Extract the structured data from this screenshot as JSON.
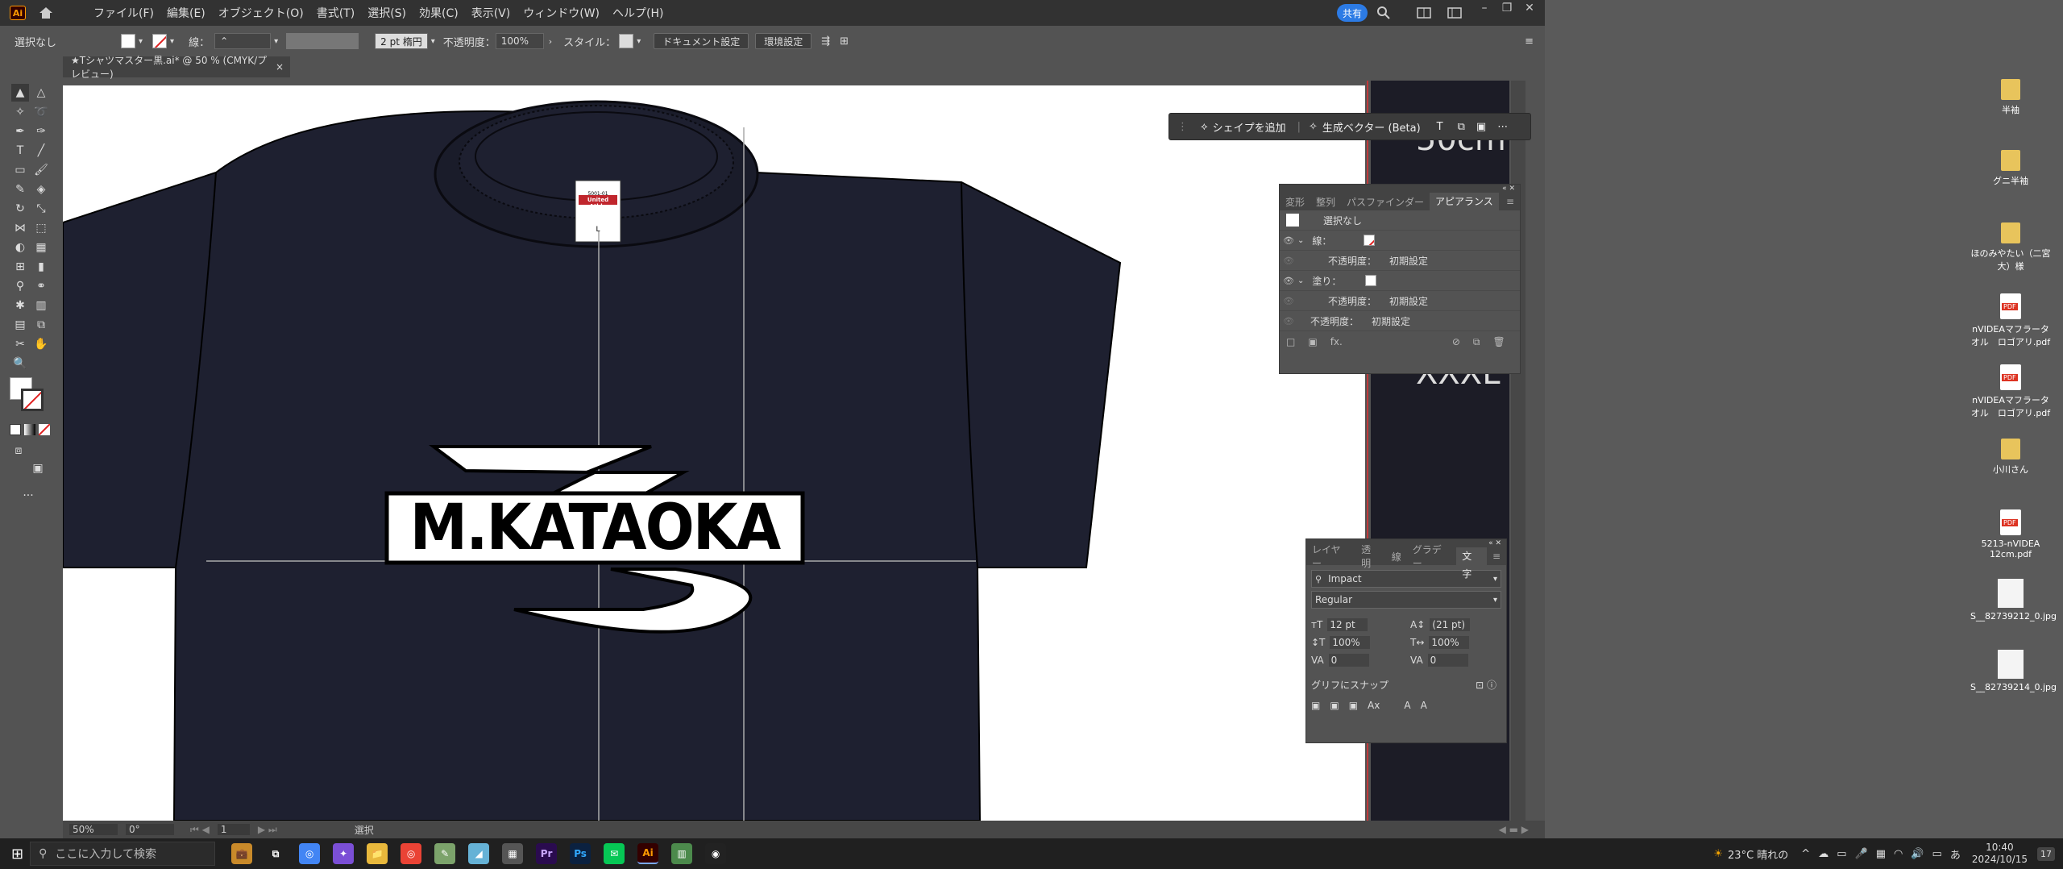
{
  "menubar": {
    "logo": "Ai",
    "items": [
      "ファイル(F)",
      "編集(E)",
      "オブジェクト(O)",
      "書式(T)",
      "選択(S)",
      "効果(C)",
      "表示(V)",
      "ウィンドウ(W)",
      "ヘルプ(H)"
    ],
    "share": "共有"
  },
  "controlbar": {
    "selection": "選択なし",
    "stroke_label": "線：",
    "stroke_style": "2 pt 楕円",
    "opacity_label": "不透明度：",
    "opacity_value": "100%",
    "style_label": "スタイル：",
    "doc_settings": "ドキュメント設定",
    "preferences": "環境設定"
  },
  "doctab": {
    "title": "★Tシャツマスター黒.ai* @ 50 % (CMYK/プレビュー)",
    "close": "×"
  },
  "artwork": {
    "logo_text": "M.KATAOKA",
    "tag_brand": "United Athle",
    "tag_size": "L",
    "tag_small1": "5001-01",
    "shirt_color": "#1e2030"
  },
  "darkstrip_text": [
    "50cm",
    "XXXL"
  ],
  "ctxbar": {
    "add_shape": "シェイプを追加",
    "gen_vector": "生成ベクター (Beta)"
  },
  "appearance_panel": {
    "tabs": [
      "変形",
      "整列",
      "パスファインダー",
      "アピアランス"
    ],
    "title": "選択なし",
    "stroke_label": "線：",
    "opacity_label": "不透明度：",
    "default": "初期設定",
    "fill_label": "塗り："
  },
  "char_panel": {
    "tabs": [
      "レイヤー",
      "透明",
      "線",
      "グラデー",
      "文字"
    ],
    "font": "Impact",
    "style": "Regular",
    "size": "12 pt",
    "leading": "(21 pt)",
    "vscale": "100%",
    "hscale": "100%",
    "kern": "0",
    "track": "0",
    "glyph_snap": "グリフにスナップ"
  },
  "statusbar": {
    "zoom": "50%",
    "rotate": "0°",
    "page": "1",
    "tool": "選択"
  },
  "desktop": {
    "icons": [
      "半袖",
      "グニ半袖",
      "ほのみやたい（二宮大）様",
      "nVIDEAマフラータオル　ロゴアリ.pdf",
      "nVIDEAマフラータオル　ロゴアリ.pdf",
      "小川さん",
      "5213-nVIDEA 12cm.pdf",
      "S__82739212_0.jpg",
      "S__82739214_0.jpg"
    ]
  },
  "taskbar": {
    "search_placeholder": "ここに入力して検索",
    "weather": "23°C 晴れの",
    "ime": "あ",
    "time": "10:40",
    "date": "2024/10/15",
    "notify": "17"
  },
  "colors": {
    "accent": "#2c7be5",
    "ui_bg": "#535353",
    "menubar": "#323232"
  }
}
